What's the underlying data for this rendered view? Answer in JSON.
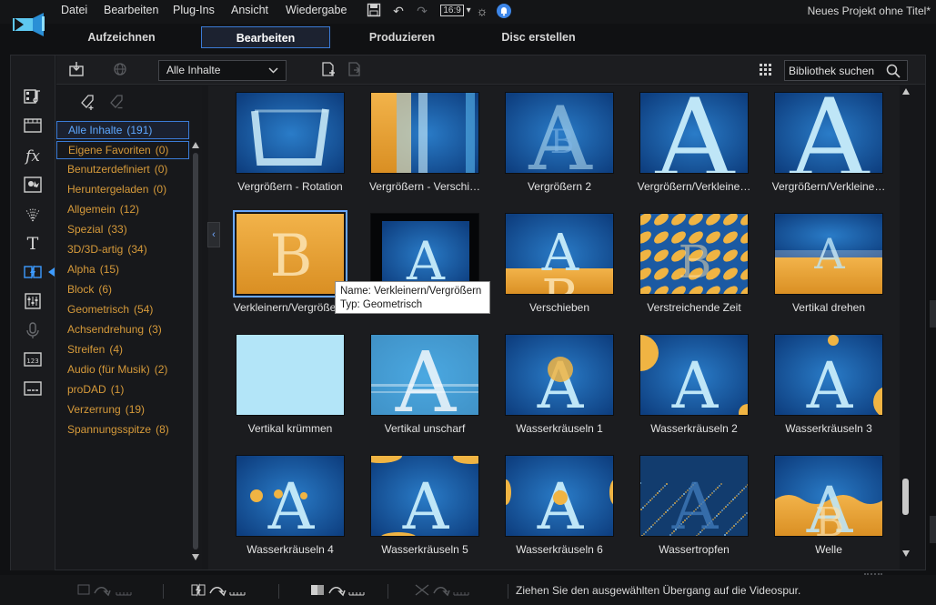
{
  "app": {
    "project_title": "Neues Projekt ohne Titel*",
    "aspect_ratio": "16:9"
  },
  "menu": {
    "items": [
      "Datei",
      "Bearbeiten",
      "Plug-Ins",
      "Ansicht",
      "Wiedergabe"
    ]
  },
  "modes": {
    "tabs": [
      "Aufzeichnen",
      "Bearbeiten",
      "Produzieren",
      "Disc erstellen"
    ],
    "active_index": 1
  },
  "library": {
    "filter_value": "Alle Inhalte",
    "search_placeholder": "Bibliothek suchen"
  },
  "categories": [
    {
      "label": "Alle Inhalte",
      "count": "(191)"
    },
    {
      "label": "Eigene Favoriten",
      "count": "(0)"
    },
    {
      "label": "Benutzerdefiniert",
      "count": "(0)"
    },
    {
      "label": "Heruntergeladen",
      "count": "(0)"
    },
    {
      "label": "Allgemein",
      "count": "(12)"
    },
    {
      "label": "Spezial",
      "count": "(33)"
    },
    {
      "label": "3D/3D-artig",
      "count": "(34)"
    },
    {
      "label": "Alpha",
      "count": "(15)"
    },
    {
      "label": "Block",
      "count": "(6)"
    },
    {
      "label": "Geometrisch",
      "count": "(54)"
    },
    {
      "label": "Achsendrehung",
      "count": "(3)"
    },
    {
      "label": "Streifen",
      "count": "(4)"
    },
    {
      "label": "Audio (für Musik)",
      "count": "(2)"
    },
    {
      "label": "proDAD",
      "count": "(1)"
    },
    {
      "label": "Verzerrung",
      "count": "(19)"
    },
    {
      "label": "Spannungsspitze",
      "count": "(8)"
    }
  ],
  "transitions": [
    {
      "label": "Vergrößern - Rotation",
      "style": "rotation"
    },
    {
      "label": "Vergrößern - Verschi…",
      "style": "split"
    },
    {
      "label": "Vergrößern 2",
      "style": "blurA"
    },
    {
      "label": "Vergrößern/Verkleine…",
      "style": "bigA"
    },
    {
      "label": "Vergrößern/Verkleine…",
      "style": "bigA"
    },
    {
      "label": "Verkleinern/Vergröße…",
      "style": "orangeB"
    },
    {
      "label": "",
      "style": "darkA"
    },
    {
      "label": "Verschieben",
      "style": "slideA"
    },
    {
      "label": "Verstreichende Zeit",
      "style": "pattern"
    },
    {
      "label": "Vertikal drehen",
      "style": "flip"
    },
    {
      "label": "Vertikal krümmen",
      "style": "lightblue"
    },
    {
      "label": "Vertikal unscharf",
      "style": "glowA"
    },
    {
      "label": "Wasserkräuseln 1",
      "style": "ripple1"
    },
    {
      "label": "Wasserkräuseln 2",
      "style": "ripple2"
    },
    {
      "label": "Wasserkräuseln 3",
      "style": "ripple3"
    },
    {
      "label": "Wasserkräuseln 4",
      "style": "ripple4"
    },
    {
      "label": "Wasserkräuseln 5",
      "style": "ripple5"
    },
    {
      "label": "Wasserkräuseln 6",
      "style": "ripple6"
    },
    {
      "label": "Wassertropfen",
      "style": "drops"
    },
    {
      "label": "Welle",
      "style": "wave"
    }
  ],
  "tooltip": {
    "name_line": "Name: Verkleinern/Vergrößern",
    "type_line": "Typ: Geometrisch"
  },
  "status": {
    "hint": "Ziehen Sie den ausgewählten Übergang auf die Videospur."
  },
  "icons": {
    "rail": [
      "media-room-icon",
      "video-room-icon",
      "fx-room-icon",
      "pip-room-icon",
      "particle-room-icon",
      "title-room-icon",
      "transition-room-icon",
      "audio-mixing-room-icon",
      "voice-over-icon",
      "chapter-room-icon",
      "subtitle-room-icon"
    ]
  },
  "colors": {
    "accent": "#3b7bd6",
    "category_text": "#d69a3a",
    "thumb_blue": "#1a5aa0",
    "thumb_orange": "#e8a030"
  }
}
